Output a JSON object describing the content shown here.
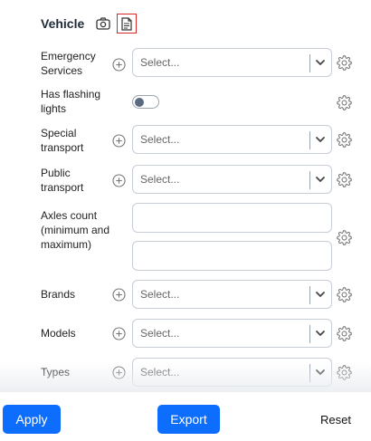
{
  "section": {
    "title": "Vehicle",
    "icons": {
      "camera": "camera-icon",
      "document": "document-icon"
    }
  },
  "fields": {
    "emergency": {
      "label": "Emergency Services",
      "placeholder": "Select..."
    },
    "flashing": {
      "label": "Has flashing lights",
      "toggle_on": false
    },
    "special": {
      "label": "Special transport",
      "placeholder": "Select..."
    },
    "public": {
      "label": "Public transport",
      "placeholder": "Select..."
    },
    "axles": {
      "label": "Axles count (minimum and maximum)",
      "min_value": "",
      "max_value": ""
    },
    "brands": {
      "label": "Brands",
      "placeholder": "Select..."
    },
    "models": {
      "label": "Models",
      "placeholder": "Select..."
    },
    "types": {
      "label": "Types",
      "placeholder": "Select..."
    }
  },
  "footer": {
    "apply_label": "Apply",
    "export_label": "Export",
    "reset_label": "Reset"
  },
  "colors": {
    "primary": "#0d6efd",
    "highlight_border": "#d62828",
    "toggle_knob": "#5b6b7f"
  }
}
